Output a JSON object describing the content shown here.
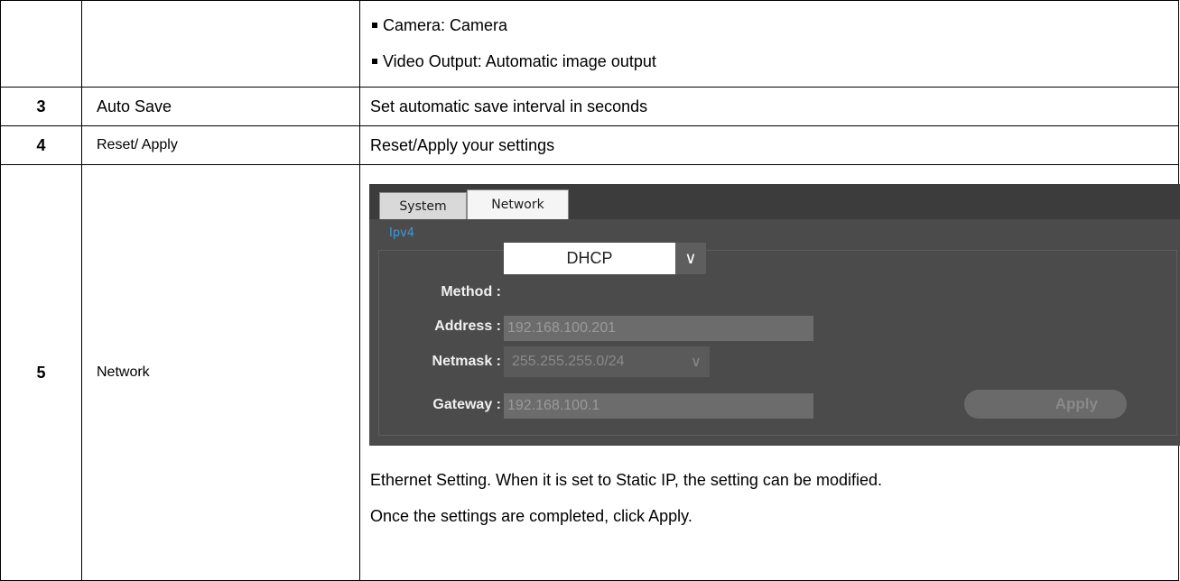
{
  "rows": {
    "top": {
      "bullets": [
        "Camera: Camera",
        "Video Output: Automatic image output"
      ]
    },
    "row3": {
      "num": "3",
      "name": "Auto Save",
      "desc": "Set automatic save interval in seconds"
    },
    "row4": {
      "num": "4",
      "name": "Reset/ Apply",
      "desc": "Reset/Apply your settings"
    },
    "row5": {
      "num": "5",
      "name": "Network",
      "paragraphs": [
        "Ethernet Setting. When it is set to Static IP, the setting can be modified.",
        "Once the settings are completed, click Apply."
      ]
    }
  },
  "dialog": {
    "tabs": [
      "System",
      "Network"
    ],
    "active_tab": "Network",
    "group_label": "Ipv4",
    "method": {
      "label": "Method :",
      "value": "DHCP"
    },
    "address": {
      "label": "Address :",
      "value": "192.168.100.201"
    },
    "netmask": {
      "label": "Netmask :",
      "value": "255.255.255.0/24"
    },
    "gateway": {
      "label": "Gateway :",
      "value": "192.168.100.1"
    },
    "apply_label": "Apply",
    "colors": {
      "accent": "#3a9bd8",
      "panel": "#4b4b4b",
      "titlebar": "#3c3c3c"
    }
  }
}
